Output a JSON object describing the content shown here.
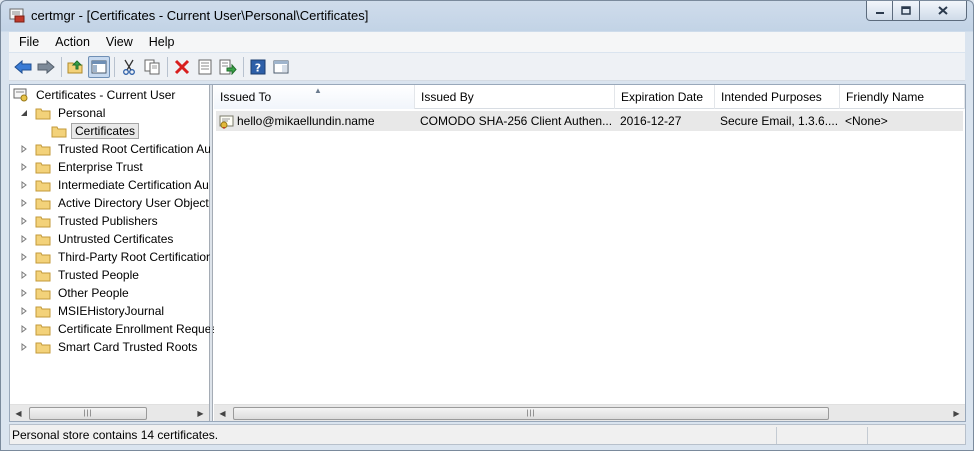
{
  "window": {
    "title": "certmgr - [Certificates - Current User\\Personal\\Certificates]"
  },
  "menu": [
    "File",
    "Action",
    "View",
    "Help"
  ],
  "toolbar": {
    "buttons": [
      "back-icon",
      "forward-icon",
      "up-folder-icon",
      "show-hide-tree-icon",
      "cut-icon",
      "copy-icon",
      "delete-icon",
      "properties-icon",
      "export-list-icon",
      "help-icon",
      "action-pane-icon"
    ]
  },
  "tree": {
    "root": "Certificates - Current User",
    "personal": "Personal",
    "certificates": "Certificates",
    "items": [
      "Trusted Root Certification Au",
      "Enterprise Trust",
      "Intermediate Certification Au",
      "Active Directory User Object",
      "Trusted Publishers",
      "Untrusted Certificates",
      "Third-Party Root Certification",
      "Trusted People",
      "Other People",
      "MSIEHistoryJournal",
      "Certificate Enrollment Reques",
      "Smart Card Trusted Roots"
    ]
  },
  "list": {
    "columns": [
      "Issued To",
      "Issued By",
      "Expiration Date",
      "Intended Purposes",
      "Friendly Name"
    ],
    "rows": [
      {
        "issued_to": "hello@mikaellundin.name",
        "issued_by": "COMODO SHA-256 Client Authen...",
        "expiration": "2016-12-27",
        "purposes": "Secure Email, 1.3.6....",
        "friendly_name": "<None>"
      }
    ]
  },
  "status": {
    "text": "Personal store contains 14 certificates."
  },
  "colors": {
    "folder": "#f3d27a",
    "accent": "#3a6ea5",
    "delete": "#d81e1e"
  }
}
